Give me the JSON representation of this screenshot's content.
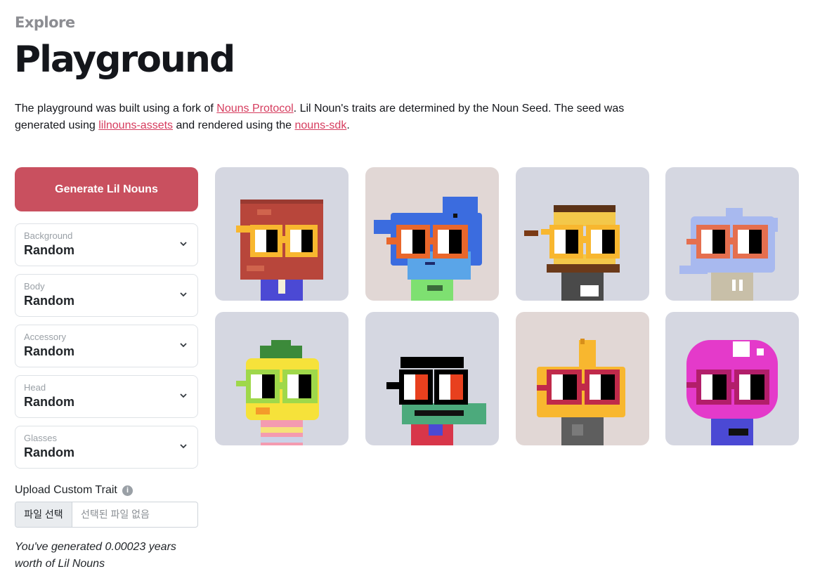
{
  "header": {
    "eyebrow": "Explore",
    "title": "Playground"
  },
  "intro": {
    "text_1": "The playground was built using a fork of ",
    "link_1": "Nouns Protocol",
    "text_2": ". Lil Noun's traits are determined by the Noun Seed. The seed was generated using ",
    "link_2": "lilnouns-assets",
    "text_3": " and rendered using the ",
    "link_3": "nouns-sdk",
    "text_4": "."
  },
  "sidebar": {
    "generate_label": "Generate Lil Nouns",
    "selects": [
      {
        "label": "Background",
        "value": "Random"
      },
      {
        "label": "Body",
        "value": "Random"
      },
      {
        "label": "Accessory",
        "value": "Random"
      },
      {
        "label": "Head",
        "value": "Random"
      },
      {
        "label": "Glasses",
        "value": "Random"
      }
    ],
    "upload_label": "Upload Custom Trait",
    "info_icon": "info-icon",
    "file_button": "파일 선택",
    "file_status": "선택된 파일 없음",
    "generated_text": "You've generated 0.00023 years worth of Lil Nouns"
  },
  "colors": {
    "accent": "#c9505f",
    "link": "#d63c5e",
    "bg_cool": "#d5d7e1",
    "bg_warm": "#e1d7d5"
  },
  "nouns": [
    {
      "background": "#d5d7e1",
      "head": "brick",
      "glasses": "yellow"
    },
    {
      "background": "#e1d7d5",
      "head": "blue-bird",
      "glasses": "orange"
    },
    {
      "background": "#d5d7e1",
      "head": "smore",
      "glasses": "yellow"
    },
    {
      "background": "#d5d7e1",
      "head": "ghost",
      "glasses": "coral"
    },
    {
      "background": "#d5d7e1",
      "head": "pineapple",
      "glasses": "lime"
    },
    {
      "background": "#d5d7e1",
      "head": "black-hair",
      "glasses": "black-red"
    },
    {
      "background": "#e1d7d5",
      "head": "thumbs-up",
      "glasses": "magenta"
    },
    {
      "background": "#d5d7e1",
      "head": "pink-mushroom",
      "glasses": "magenta"
    }
  ]
}
